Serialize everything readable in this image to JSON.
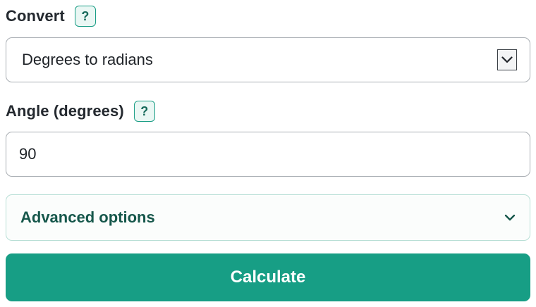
{
  "convert": {
    "label": "Convert",
    "help_label": "?",
    "selected_option": "Degrees to radians"
  },
  "angle": {
    "label": "Angle (degrees)",
    "help_label": "?",
    "value": "90"
  },
  "advanced": {
    "label": "Advanced options"
  },
  "calculate": {
    "label": "Calculate"
  },
  "colors": {
    "accent": "#179e85",
    "accent_dark_text": "#16574b",
    "help_bg": "#eaf7f4",
    "input_border": "#a9aeb3"
  },
  "icons": {
    "select_caret": "chevron-down-icon",
    "advanced_chevron": "chevron-down-icon"
  }
}
